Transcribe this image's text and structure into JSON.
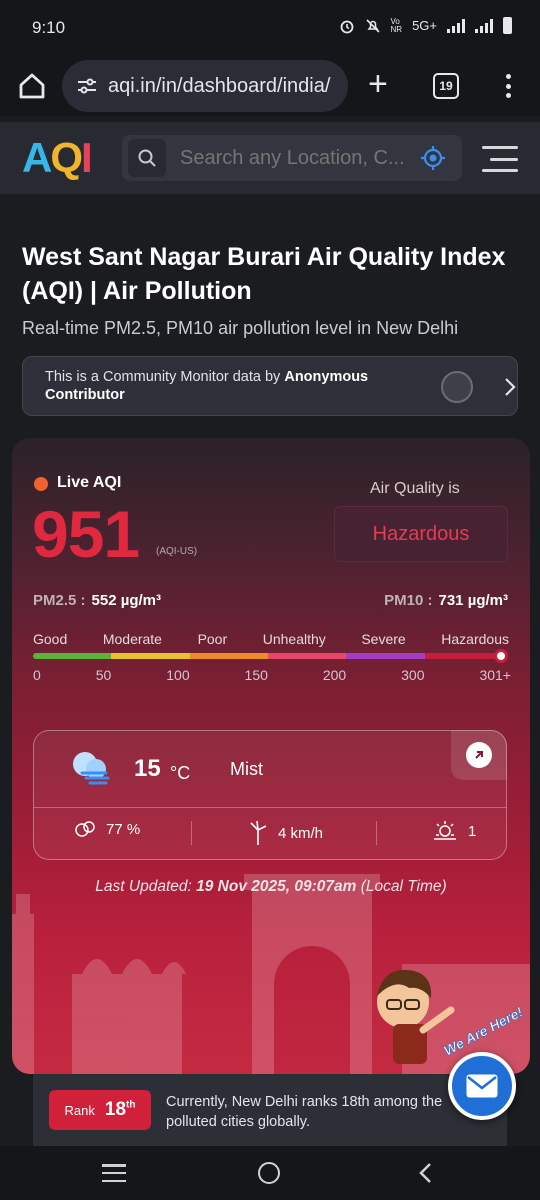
{
  "statusbar": {
    "time": "9:10",
    "network": "5G+"
  },
  "browser": {
    "url": "aqi.in/in/dashboard/india/",
    "tab_count": "19"
  },
  "site": {
    "logo": "AQI",
    "search_placeholder": "Search any Location, C..."
  },
  "page": {
    "title": "West Sant Nagar Burari Air Quality Index (AQI) | Air Pollution",
    "subtitle": "Real-time PM2.5, PM10 air pollution level in New Delhi",
    "community_prefix": "This is a Community Monitor data by ",
    "community_contributor": "Anonymous Contributor"
  },
  "aqi": {
    "live_label": "Live AQI",
    "value": "951",
    "unit": "(AQI-US)",
    "air_quality_is": "Air Quality is",
    "status": "Hazardous",
    "status_color": "#e83a50",
    "pm25_label": "PM2.5 :",
    "pm25_value": "552 µg/m³",
    "pm10_label": "PM10 :",
    "pm10_value": "731 µg/m³",
    "scale_labels": [
      "Good",
      "Moderate",
      "Poor",
      "Unhealthy",
      "Severe",
      "Hazardous"
    ],
    "scale_numbers": [
      "0",
      "50",
      "100",
      "150",
      "200",
      "300",
      "301+"
    ],
    "scale_colors": [
      "#59b43c",
      "#e8c22e",
      "#ef8a2a",
      "#e8476a",
      "#a33ec4",
      "#c51d3c"
    ]
  },
  "weather": {
    "temperature": "15",
    "temp_unit": "°C",
    "condition": "Mist",
    "icon": "mist-cloud-icon",
    "humidity": "77 %",
    "wind": "4 km/h",
    "uv": "1"
  },
  "updated": {
    "prefix": "Last Updated: ",
    "datetime": "19 Nov 2025, 09:07am",
    "suffix": " (Local Time)"
  },
  "mascot": {
    "text": "We Are Here!"
  },
  "rank": {
    "label": "Rank",
    "number": "18",
    "suffix": "th",
    "text": "Currently, New Delhi ranks 18th among the polluted cities globally."
  }
}
